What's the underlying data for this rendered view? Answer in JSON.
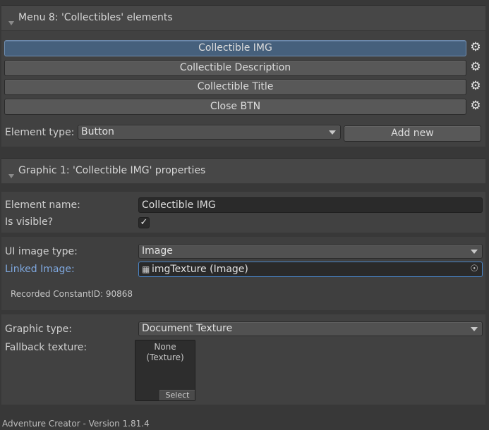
{
  "menu_section": {
    "title": "Menu 8: 'Collectibles' elements",
    "elements": [
      {
        "label": "Collectible IMG",
        "selected": true
      },
      {
        "label": "Collectible Description",
        "selected": false
      },
      {
        "label": "Collectible Title",
        "selected": false
      },
      {
        "label": "Close BTN",
        "selected": false
      }
    ],
    "element_type_label": "Element type:",
    "element_type_value": "Button",
    "add_new_label": "Add new"
  },
  "graphic_section": {
    "title": "Graphic 1: 'Collectible IMG' properties",
    "element_name_label": "Element name:",
    "element_name_value": "Collectible IMG",
    "is_visible_label": "Is visible?",
    "is_visible_checked": true,
    "ui_image_type_label": "UI image type:",
    "ui_image_type_value": "Image",
    "linked_image_label": "Linked Image:",
    "linked_image_value": "imgTexture (Image)",
    "recorded_constant_id": "Recorded ConstantID: 90868",
    "graphic_type_label": "Graphic type:",
    "graphic_type_value": "Document Texture",
    "fallback_texture_label": "Fallback texture:",
    "texture_none_line1": "None",
    "texture_none_line2": "(Texture)",
    "texture_select_label": "Select"
  },
  "footer": {
    "version_text": "Adventure Creator - Version 1.81.4"
  },
  "colors": {
    "background": "#383838",
    "selected_element": "#46607c",
    "link_label": "#7fa8df",
    "object_field_border": "#4a86c8"
  }
}
